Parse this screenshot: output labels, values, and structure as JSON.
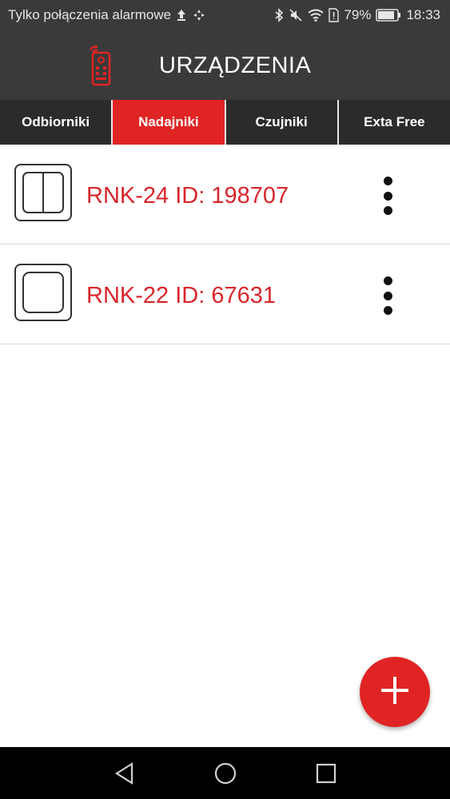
{
  "status_bar": {
    "carrier_text": "Tylko połączenia alarmowe",
    "battery_percent": "79%",
    "time": "18:33",
    "icons": [
      "upload-icon",
      "sync-icon",
      "bluetooth-icon",
      "mute-icon",
      "wifi-icon",
      "sim-alert-icon",
      "battery-icon"
    ]
  },
  "header": {
    "title": "URZĄDZENIA",
    "icon": "remote-control-icon",
    "accent": "#e02424"
  },
  "tabs": [
    {
      "label": "Odbiorniki",
      "active": false
    },
    {
      "label": "Nadajniki",
      "active": true
    },
    {
      "label": "Czujniki",
      "active": false
    },
    {
      "label": "Exta Free",
      "active": false
    }
  ],
  "devices": [
    {
      "name": "RNK-24 ID: 198707",
      "icon": "double-switch-icon"
    },
    {
      "name": "RNK-22 ID: 67631",
      "icon": "single-switch-icon"
    }
  ],
  "fab": {
    "icon": "plus-icon"
  },
  "nav": {
    "icons": [
      "back-icon",
      "home-icon",
      "recents-icon"
    ]
  },
  "colors": {
    "bar": "#3a3a3a",
    "tab_bg": "#2b2b2b",
    "accent": "#e02424",
    "device_text": "#d8262b"
  }
}
